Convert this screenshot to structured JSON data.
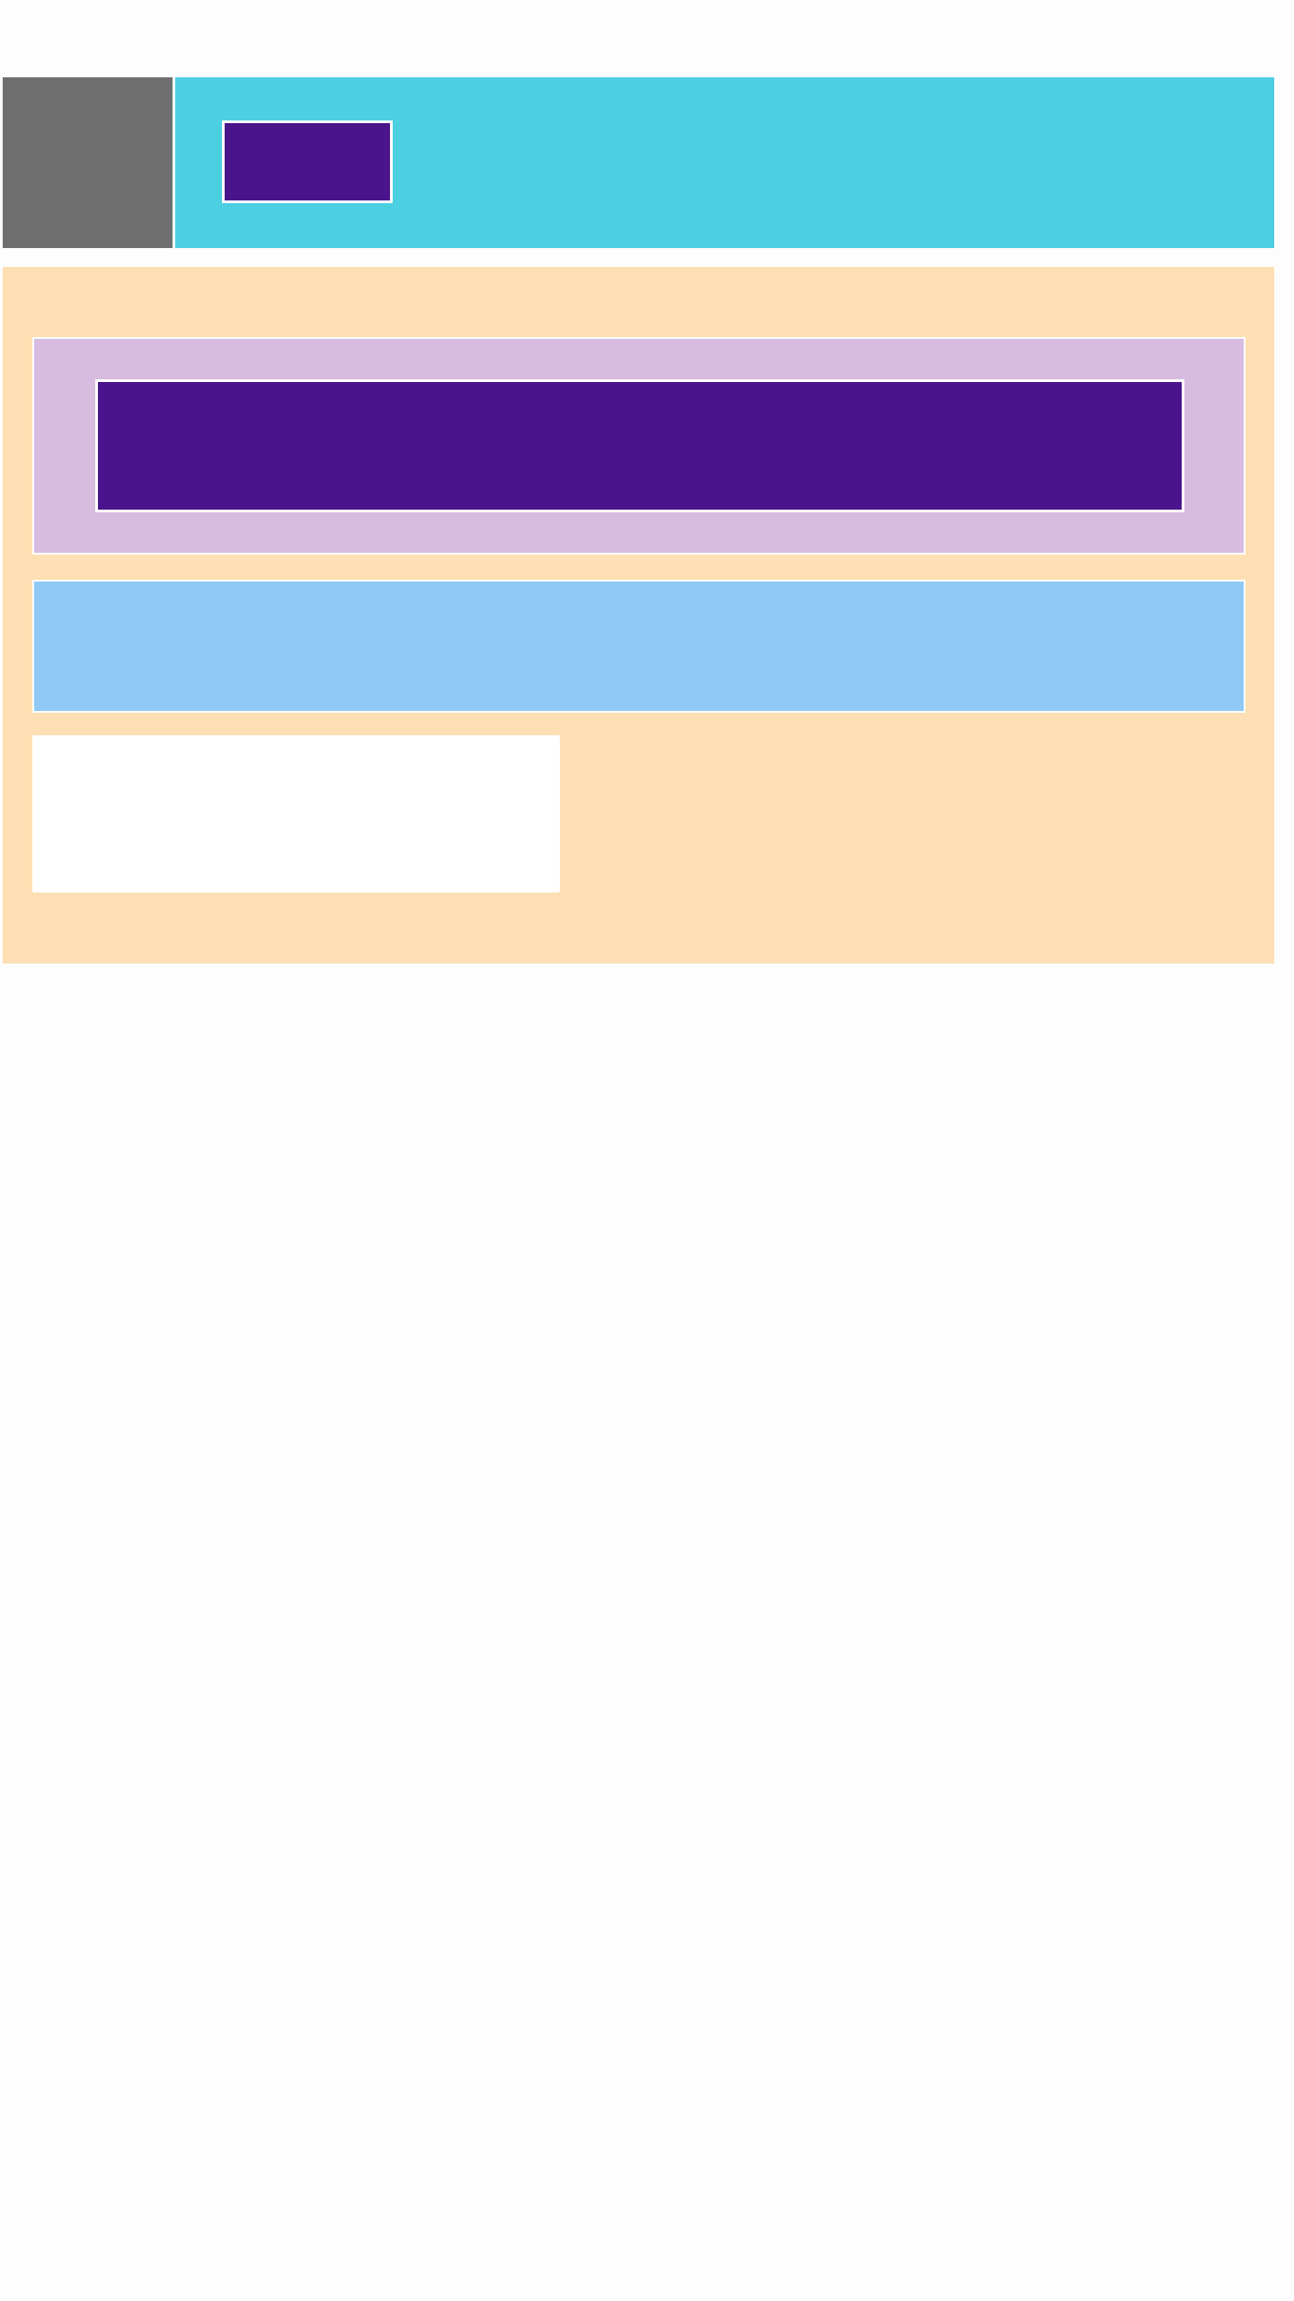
{
  "colors": {
    "page_background": "#fdfdfd",
    "header_left": "#6f6f6f",
    "header_right": "#4ccfe1",
    "header_button": "#4a148c",
    "main_background": "#fddfb3",
    "section_purple": "#d7bce0",
    "banner": "#4a148c",
    "section_blue": "#91c9f6",
    "card": "#ffffff",
    "borders": "#ffffff"
  }
}
